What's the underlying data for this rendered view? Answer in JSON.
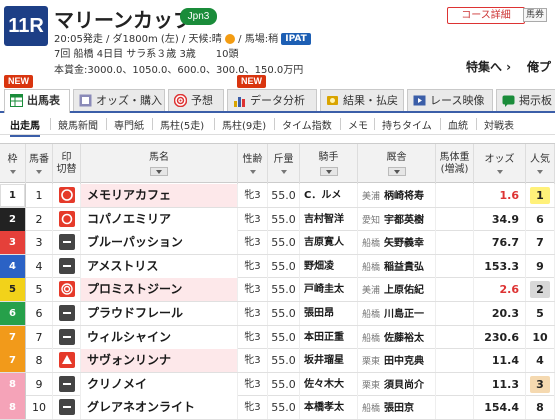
{
  "race": {
    "number": "11R",
    "name": "マリーンカップ",
    "grade": "Jpn3",
    "line1_start": "20:05発走 / ダ1800m (左) / 天候:晴",
    "line1_track": " / 馬場:稍",
    "ipat": "IPAT",
    "line2": "7回 船橋 4日目 サラ系３歳 3歳　　10頭",
    "line3": "本賞金:3000.0、1050.0、600.0、300.0、150.0万円",
    "course_link": "コース詳細",
    "fav_label": "馬券",
    "special_link": "特集へ ›",
    "ba_link": "俺プ"
  },
  "badges": {
    "new1": "NEW",
    "new2": "NEW"
  },
  "tabs": [
    {
      "label": "出馬表",
      "icon": "table-icon",
      "color": "#1a8c3a"
    },
    {
      "label": "オッズ・購入",
      "icon": "odds-icon",
      "color": "#6a6a9a"
    },
    {
      "label": "予想",
      "icon": "target-icon",
      "color": "#d33"
    },
    {
      "label": "データ分析",
      "icon": "chart-icon",
      "color": "#d9a400"
    },
    {
      "label": "結果・払戻",
      "icon": "coin-icon",
      "color": "#d9a400"
    },
    {
      "label": "レース映像",
      "icon": "video-icon",
      "color": "#3b5ea8"
    },
    {
      "label": "掲示板",
      "icon": "board-icon",
      "color": "#1a8c3a"
    }
  ],
  "subnav": [
    "出走馬",
    "競馬新聞",
    "専門紙",
    "馬柱(5走)",
    "馬柱(9走)",
    "タイム指数",
    "メモ",
    "持ちタイム",
    "血統",
    "対戦表"
  ],
  "headers": {
    "waku": "枠",
    "uma": "馬番",
    "mark1": "印",
    "mark2": "切替",
    "horse": "馬名",
    "sex": "性齢",
    "kin": "斤量",
    "jockey": "騎手",
    "trainer": "厩舎",
    "weight1": "馬体重",
    "weight2": "(増減)",
    "odds": "オッズ",
    "ninki": "人気"
  },
  "waku_colors": {
    "1": {
      "bg": "#ffffff",
      "fg": "#222"
    },
    "2": {
      "bg": "#222222",
      "fg": "#fff"
    },
    "3": {
      "bg": "#e5403a",
      "fg": "#fff"
    },
    "4": {
      "bg": "#2b62c5",
      "fg": "#fff"
    },
    "5": {
      "bg": "#f2d21a",
      "fg": "#222"
    },
    "6": {
      "bg": "#26a04a",
      "fg": "#fff"
    },
    "7": {
      "bg": "#f29a1a",
      "fg": "#fff"
    },
    "8": {
      "bg": "#f5a3b8",
      "fg": "#fff"
    }
  },
  "rows": [
    {
      "waku": "1",
      "uma": "1",
      "mark": "circle-mark-icon",
      "mark_color": "#e53a2a",
      "horse": "メモリアカフェ",
      "sex": "牝3",
      "kin": "55.0",
      "jockey": "C．ルメ",
      "area": "美浦",
      "trainer": "柄崎将寿",
      "odds": "1.6",
      "odds_color": "#d33",
      "ninki": "1",
      "ninki_bg": "#fff17a",
      "row_bg": "#fde8ea"
    },
    {
      "waku": "2",
      "uma": "2",
      "mark": "circle-outline-mark-icon",
      "mark_color": "#e53a2a",
      "horse": "コパノエミリア",
      "sex": "牝3",
      "kin": "55.0",
      "jockey": "吉村智洋",
      "area": "愛知",
      "trainer": "宇都英樹",
      "odds": "34.9",
      "odds_color": "#222",
      "ninki": "6",
      "ninki_bg": "#fff",
      "row_bg": "#fff"
    },
    {
      "waku": "3",
      "uma": "3",
      "mark": "dash-mark-icon",
      "mark_color": "#333",
      "horse": "ブルーパッション",
      "sex": "牝3",
      "kin": "55.0",
      "jockey": "吉原寛人",
      "area": "船橋",
      "trainer": "矢野義幸",
      "odds": "76.7",
      "odds_color": "#222",
      "ninki": "7",
      "ninki_bg": "#fff",
      "row_bg": "#fff"
    },
    {
      "waku": "4",
      "uma": "4",
      "mark": "dash-mark-icon",
      "mark_color": "#333",
      "horse": "アメストリス",
      "sex": "牝3",
      "kin": "55.0",
      "jockey": "野畑凌",
      "area": "船橋",
      "trainer": "稲益貴弘",
      "odds": "153.3",
      "odds_color": "#222",
      "ninki": "9",
      "ninki_bg": "#fff",
      "row_bg": "#fff"
    },
    {
      "waku": "5",
      "uma": "5",
      "mark": "target-mark-icon",
      "mark_color": "#e53a2a",
      "horse": "プロミストジーン",
      "sex": "牝3",
      "kin": "55.0",
      "jockey": "戸崎圭太",
      "area": "美浦",
      "trainer": "上原佑紀",
      "odds": "2.6",
      "odds_color": "#d33",
      "ninki": "2",
      "ninki_bg": "#d8d8d8",
      "row_bg": "#fde8ea"
    },
    {
      "waku": "6",
      "uma": "6",
      "mark": "dash-mark-icon",
      "mark_color": "#333",
      "horse": "プラウドフレール",
      "sex": "牝3",
      "kin": "55.0",
      "jockey": "張田昂",
      "area": "船橋",
      "trainer": "川島正一",
      "odds": "20.3",
      "odds_color": "#222",
      "ninki": "5",
      "ninki_bg": "#fff",
      "row_bg": "#fff"
    },
    {
      "waku": "7",
      "uma": "7",
      "mark": "dash-mark-icon",
      "mark_color": "#333",
      "horse": "ウィルシャイン",
      "sex": "牝3",
      "kin": "55.0",
      "jockey": "本田正重",
      "area": "船橋",
      "trainer": "佐藤裕太",
      "odds": "230.6",
      "odds_color": "#222",
      "ninki": "10",
      "ninki_bg": "#fff",
      "row_bg": "#fff"
    },
    {
      "waku": "7",
      "uma": "8",
      "mark": "triangle-mark-icon",
      "mark_color": "#e53a2a",
      "horse": "サヴォンリンナ",
      "sex": "牝3",
      "kin": "55.0",
      "jockey": "坂井瑠星",
      "area": "栗東",
      "trainer": "田中克典",
      "odds": "11.4",
      "odds_color": "#222",
      "ninki": "4",
      "ninki_bg": "#fff",
      "row_bg": "#fde8ea"
    },
    {
      "waku": "8",
      "uma": "9",
      "mark": "dash-mark-icon",
      "mark_color": "#333",
      "horse": "クリノメイ",
      "sex": "牝3",
      "kin": "55.0",
      "jockey": "佐々木大",
      "area": "栗東",
      "trainer": "須貝尚介",
      "odds": "11.3",
      "odds_color": "#222",
      "ninki": "3",
      "ninki_bg": "#f5d9b0",
      "row_bg": "#fff"
    },
    {
      "waku": "8",
      "uma": "10",
      "mark": "dash-mark-icon",
      "mark_color": "#333",
      "horse": "グレアネオンライト",
      "sex": "牝3",
      "kin": "55.0",
      "jockey": "本橋孝太",
      "area": "船橋",
      "trainer": "張田京",
      "odds": "154.4",
      "odds_color": "#222",
      "ninki": "8",
      "ninki_bg": "#fff",
      "row_bg": "#fff"
    }
  ]
}
